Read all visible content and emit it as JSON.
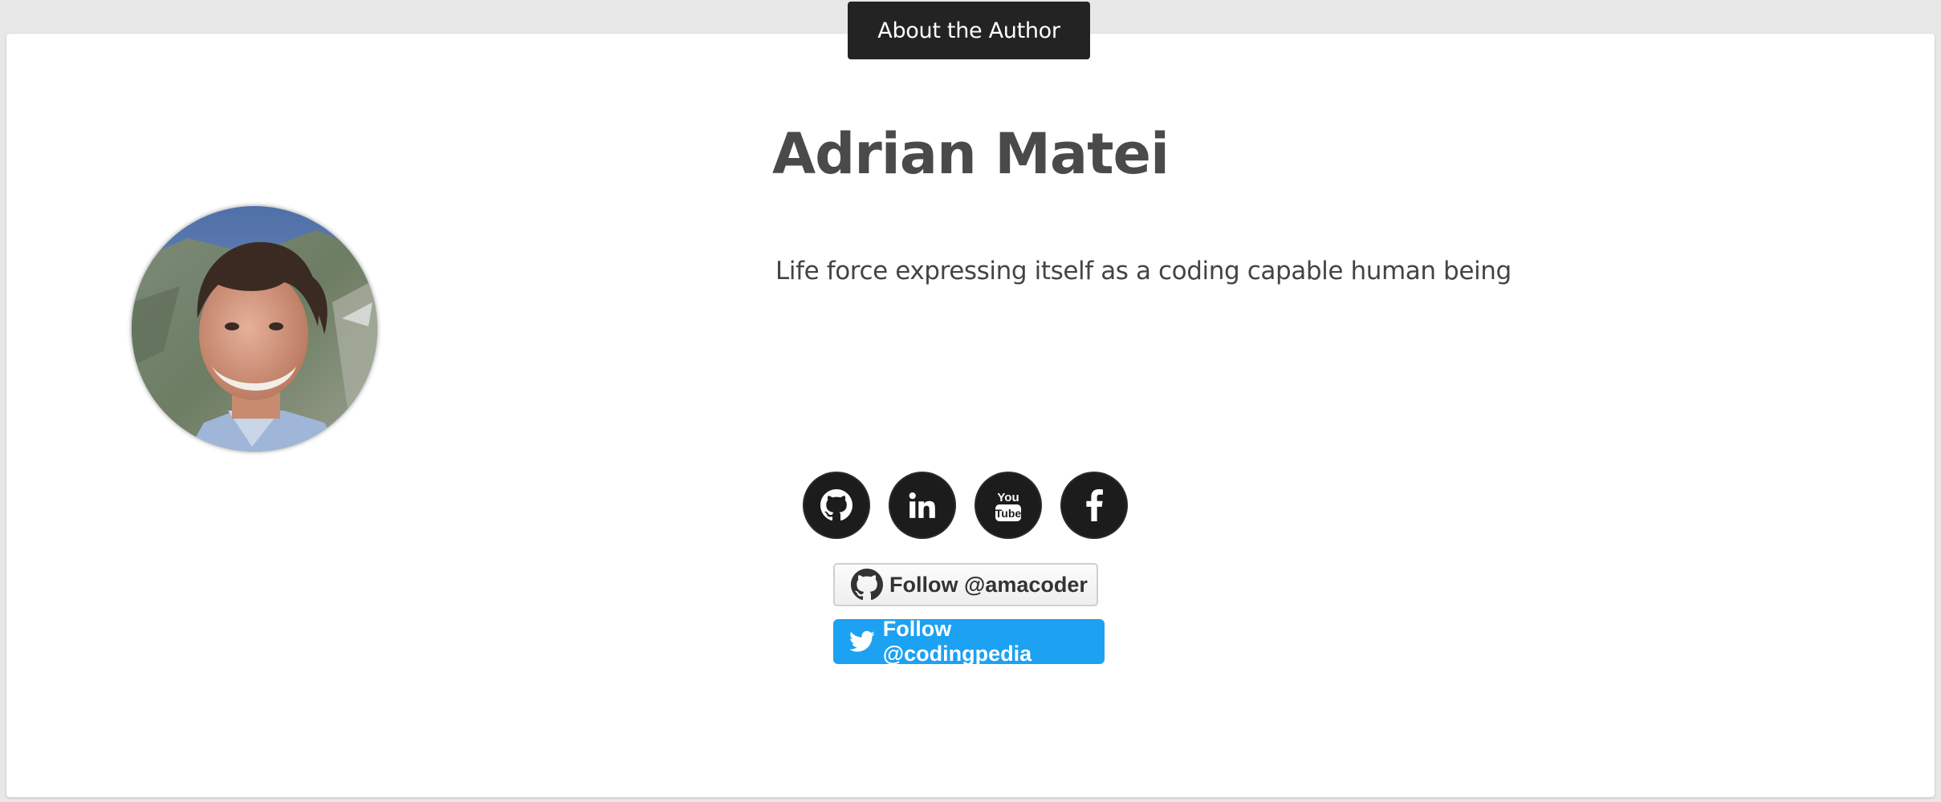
{
  "header": {
    "tab_label": "About the Author"
  },
  "author": {
    "name": "Adrian Matei",
    "bio": "Life force expressing itself as a coding capable human being"
  },
  "social_links": [
    {
      "network": "GitHub",
      "icon": "github-icon"
    },
    {
      "network": "LinkedIn",
      "icon": "linkedin-icon"
    },
    {
      "network": "YouTube",
      "icon": "youtube-icon",
      "glyph_top": "You",
      "glyph_bottom": "Tube"
    },
    {
      "network": "Facebook",
      "icon": "facebook-icon"
    }
  ],
  "follow_buttons": {
    "github": {
      "label": "Follow @amacoder",
      "icon": "github-icon"
    },
    "twitter": {
      "label": "Follow @codingpedia",
      "icon": "twitter-bird-icon"
    }
  },
  "colors": {
    "header_bg": "#232323",
    "social_bg": "#1c1c1c",
    "twitter_blue": "#1da1f2",
    "text": "#4a4a4a"
  }
}
